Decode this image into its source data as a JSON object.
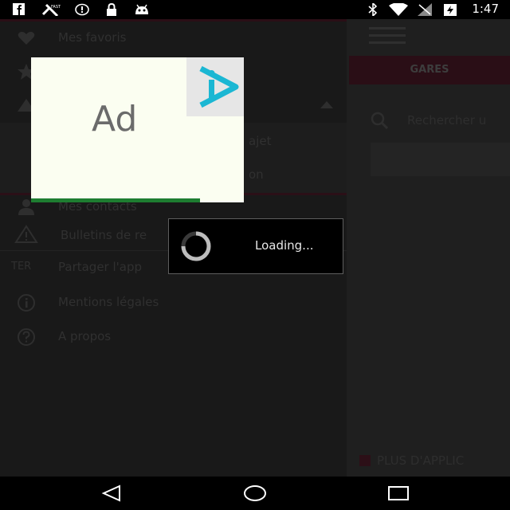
{
  "status_bar": {
    "time": "1:47",
    "icons": [
      "facebook-icon",
      "satellite-icon",
      "alert-icon",
      "lock-icon",
      "android-icon",
      "bluetooth-icon",
      "wifi-icon",
      "signal-icon",
      "battery-icon"
    ],
    "satellite_label": "FAST"
  },
  "drawer": {
    "items": [
      {
        "label": "Mes favoris",
        "icon": "heart-icon"
      },
      {
        "label": "",
        "icon": "star-icon"
      },
      {
        "label": "",
        "icon": "train-icon"
      },
      {
        "label": "ajet",
        "icon": ""
      },
      {
        "label": "on",
        "icon": ""
      },
      {
        "label": "Mes contacts",
        "icon": "person-icon"
      },
      {
        "label": "Bulletins de re",
        "icon": "warning-icon"
      },
      {
        "label": "Partager l'app",
        "icon": "ter-icon",
        "prefix": "TER"
      },
      {
        "label": "Mentions légales",
        "icon": "info-icon"
      },
      {
        "label": "A propos",
        "icon": "question-icon"
      }
    ]
  },
  "right_panel": {
    "tab": "GARES",
    "search_placeholder": "Rechercher u",
    "more_apps": "PLUS D'APPLIC"
  },
  "ad": {
    "label": "Ad"
  },
  "dialog": {
    "loading_text": "Loading..."
  },
  "colors": {
    "accent": "#2a0e16",
    "dim_text": "#303030",
    "ad_bg": "#fbfef1",
    "ad_logo": "#1bb7d3"
  }
}
